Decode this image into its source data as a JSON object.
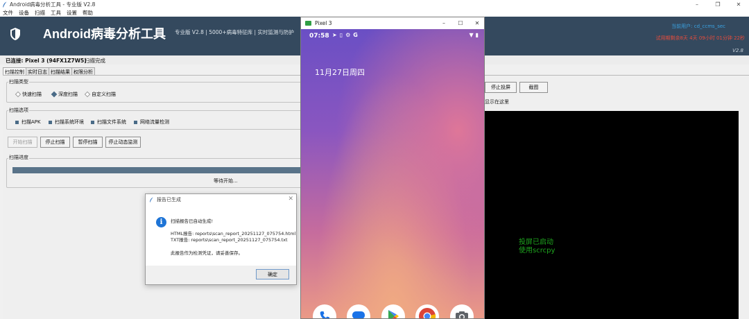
{
  "main_window": {
    "title": "Android病毒分析工具 - 专业版 V2.8",
    "menu": [
      "文件",
      "设备",
      "扫描",
      "工具",
      "设置",
      "帮助"
    ]
  },
  "header": {
    "app_name": "Android病毒分析工具",
    "subtitle": "专业版 V2.8 | 5000+病毒特征库 | 实时监测与防护",
    "user": "当前用户: cd_ccms_sec",
    "trial": "试用期剩余8天 4天 09小时 01分钟 22秒",
    "version": "V2.8",
    "colors": {
      "header_bg": "#34495e",
      "user": "#3aa3e3",
      "trial": "#e74c3c"
    }
  },
  "status": {
    "device": "已连接: Pixel 3 (94FX1Z7W5)",
    "scan_state": "扫描完成"
  },
  "tabs": [
    "扫描控制",
    "实时日志",
    "扫描结果",
    "权限分析"
  ],
  "scan_type": {
    "title": "扫描类型",
    "options": [
      {
        "label": "快速扫描",
        "selected": false
      },
      {
        "label": "深度扫描",
        "selected": true
      },
      {
        "label": "自定义扫描",
        "selected": false
      }
    ]
  },
  "scan_options": {
    "title": "扫描选项",
    "items": [
      "扫描APK",
      "扫描系统环境",
      "扫描文件系统",
      "网络流量检测"
    ]
  },
  "buttons": {
    "start": "开始扫描",
    "stop": "停止扫描",
    "pause": "暂停扫描",
    "stop_monitor": "停止动态监测"
  },
  "progress": {
    "title": "扫描进度",
    "status_text": "等待开始...",
    "value": 0
  },
  "mirror": {
    "stop_button": "停止投屏",
    "screenshot_button": "截图",
    "label": "显示在这里",
    "message_line1": "投屏已启动",
    "message_line2": "使用scrcpy"
  },
  "dialog": {
    "title": "报告已生成",
    "line1": "扫描报告已自动生成!",
    "line2": "HTML报告: reports\\scan_report_20251127_075754.html",
    "line3": "TXT报告: reports\\scan_report_20251127_075754.txt",
    "line4": "此报告作为检测凭证，请妥善保存。",
    "ok": "确定"
  },
  "phone": {
    "window_title": "Pixel 3",
    "time": "07:58",
    "date": "11月27日周四",
    "dock_icons": [
      "phone-icon",
      "messages-icon",
      "play-store-icon",
      "chrome-icon",
      "camera-icon"
    ]
  }
}
